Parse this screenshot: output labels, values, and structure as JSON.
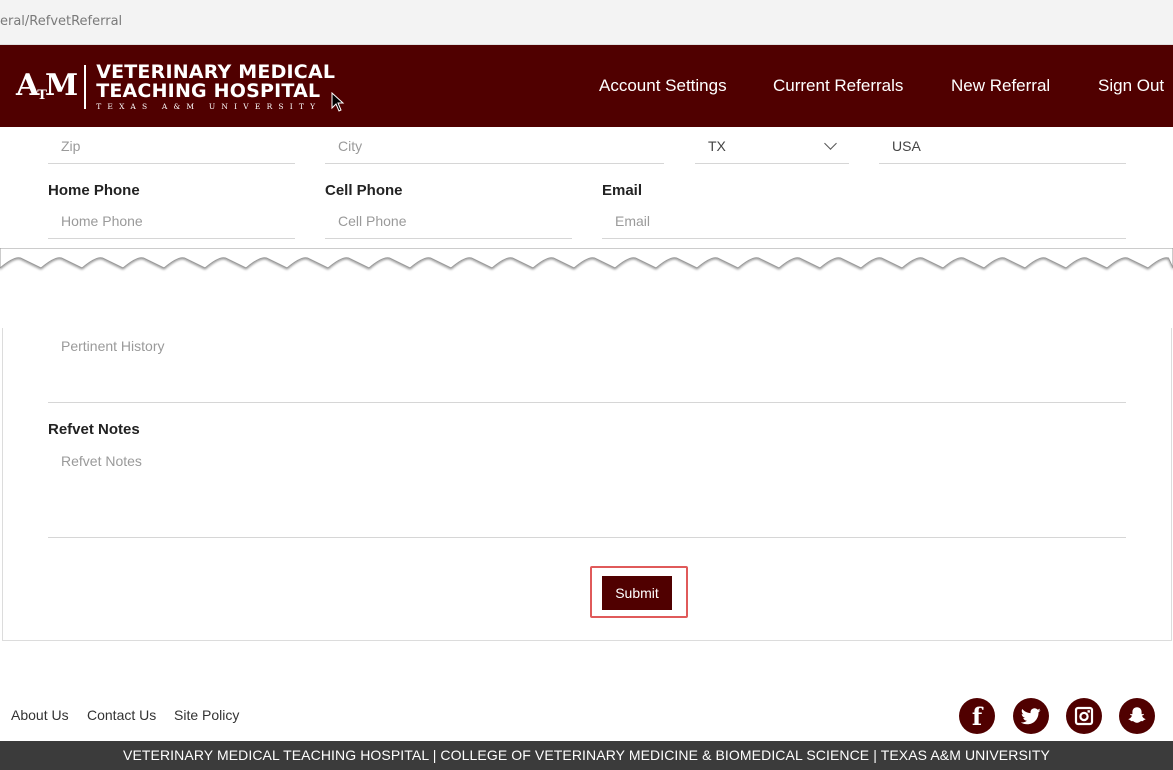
{
  "browser": {
    "url": "eral/RefvetReferral"
  },
  "header": {
    "logo": {
      "mark": "ATM",
      "line1": "VETERINARY MEDICAL",
      "line2": "TEACHING HOSPITAL",
      "line3": "TEXAS A&M UNIVERSITY"
    },
    "nav": [
      "Account Settings",
      "Current Referrals",
      "New Referral",
      "Sign Out"
    ],
    "brand_color": "#500000"
  },
  "form": {
    "zip": {
      "placeholder": "Zip"
    },
    "city": {
      "placeholder": "City"
    },
    "state": {
      "value": "TX"
    },
    "country": {
      "value": "USA"
    },
    "home_phone": {
      "label": "Home Phone",
      "placeholder": "Home Phone"
    },
    "cell_phone": {
      "label": "Cell Phone",
      "placeholder": "Cell Phone"
    },
    "email": {
      "label": "Email",
      "placeholder": "Email"
    },
    "pertinent_history": {
      "placeholder": "Pertinent History"
    },
    "refvet_notes": {
      "label": "Refvet Notes",
      "placeholder": "Refvet Notes"
    },
    "submit_label": "Submit"
  },
  "footer": {
    "links": [
      "About Us",
      "Contact Us",
      "Site Policy"
    ],
    "social_icons": [
      "facebook-icon",
      "twitter-icon",
      "instagram-icon",
      "snapchat-icon"
    ],
    "bottom_text": "VETERINARY MEDICAL TEACHING HOSPITAL | COLLEGE OF VETERINARY MEDICINE & BIOMEDICAL SCIENCE | TEXAS A&M UNIVERSITY"
  }
}
